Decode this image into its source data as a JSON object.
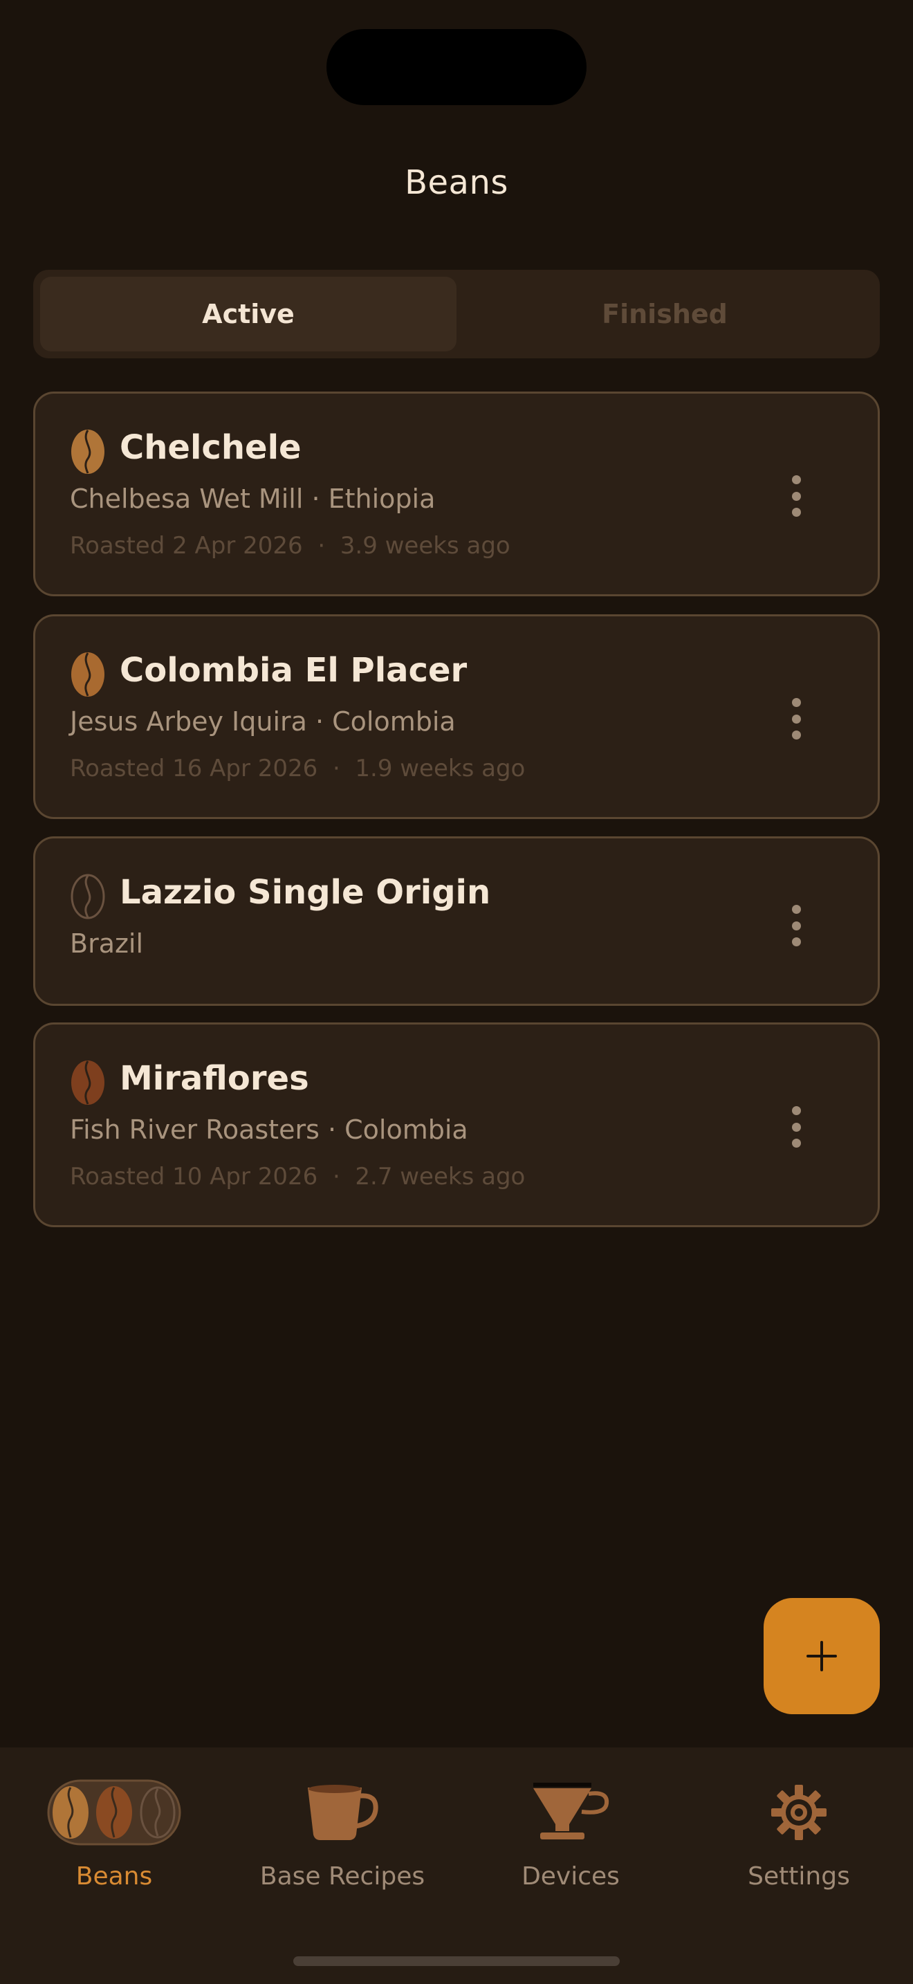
{
  "header": {
    "title": "Beans"
  },
  "segmented": {
    "active_label": "Active",
    "finished_label": "Finished"
  },
  "beans": [
    {
      "name": "Chelchele",
      "subtitle": "Chelbesa Wet Mill · Ethiopia",
      "roasted": "Roasted 2 Apr 2026",
      "age": "3.9 weeks ago",
      "bean_color": "#b07538",
      "icon": "coffee-bean-icon"
    },
    {
      "name": "Colombia El Placer",
      "subtitle": "Jesus Arbey Iquira · Colombia",
      "roasted": "Roasted 16 Apr 2026",
      "age": "1.9 weeks ago",
      "bean_color": "#a96a30",
      "icon": "coffee-bean-icon"
    },
    {
      "name": "Lazzio Single Origin",
      "subtitle": "Brazil",
      "bean_color": "#6a5240",
      "icon": "coffee-bean-outline-icon"
    },
    {
      "name": "Miraflores",
      "subtitle": "Fish River Roasters · Colombia",
      "roasted": "Roasted 10 Apr 2026",
      "age": "2.7 weeks ago",
      "bean_color": "#7e3f1e",
      "icon": "coffee-bean-icon"
    }
  ],
  "meta_separator": "·",
  "fab": {
    "icon": "plus-icon"
  },
  "tabbar": {
    "items": [
      {
        "label": "Beans",
        "icon": "beans-icon",
        "active": true
      },
      {
        "label": "Base Recipes",
        "icon": "coffee-cup-icon",
        "active": false
      },
      {
        "label": "Devices",
        "icon": "dripper-icon",
        "active": false
      },
      {
        "label": "Settings",
        "icon": "gear-icon",
        "active": false
      }
    ]
  },
  "colors": {
    "background": "#1b130c",
    "card": "#2c2016",
    "accent": "#d58420",
    "active_tab": "#d98b33"
  }
}
